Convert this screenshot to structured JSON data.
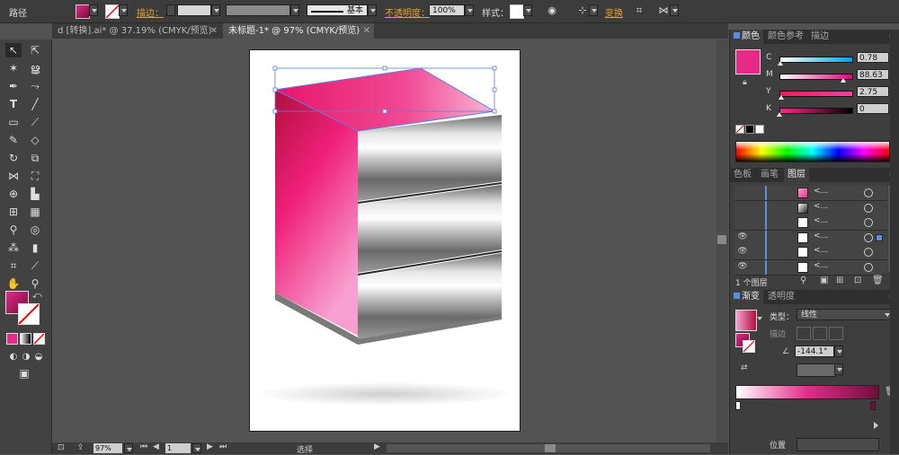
{
  "control_bar": {
    "object_type": "路径",
    "stroke_label": "描边：",
    "stroke_profile": "基本",
    "opacity_label": "不透明度：",
    "opacity_value": "100%",
    "style_label": "样式：",
    "transform_label": "变换"
  },
  "tabs": [
    {
      "label": "d [转换].ai* @ 37.19% (CMYK/预览)"
    },
    {
      "label": "未标题-1* @ 97% (CMYK/预览)"
    }
  ],
  "color_panel": {
    "tabs": [
      "颜色",
      "颜色参考",
      "描边"
    ],
    "swatch_color": "#e8298a",
    "channels": [
      {
        "key": "C",
        "value": "0.78",
        "thumb": 0.01,
        "gradient": "linear-gradient(to right,#fff,#00a0e9)"
      },
      {
        "key": "M",
        "value": "88.63",
        "thumb": 0.89,
        "gradient": "linear-gradient(to right,#fff,#e4007f)"
      },
      {
        "key": "Y",
        "value": "2.75",
        "thumb": 0.03,
        "gradient": "linear-gradient(to right,#ff1a5a,#ff3ea0)"
      },
      {
        "key": "K",
        "value": "0",
        "thumb": 0.0,
        "gradient": "linear-gradient(to right,#ff2a8a,#000)"
      }
    ]
  },
  "layers_panel": {
    "tabs": [
      "色板",
      "画笔",
      "图层"
    ],
    "rows": [
      {
        "name": "<...",
        "visible": false
      },
      {
        "name": "<...",
        "visible": false
      },
      {
        "name": "<...",
        "visible": false
      },
      {
        "name": "<...",
        "visible": true
      },
      {
        "name": "<...",
        "visible": true
      },
      {
        "name": "<...",
        "visible": true
      }
    ],
    "count": "1 个图层"
  },
  "gradient_panel": {
    "tabs": [
      "渐变",
      "透明度"
    ],
    "type_label": "类型：",
    "type_value": "线性",
    "stroke_label": "描边",
    "angle_value": "-144.1°",
    "location_label": "位置"
  },
  "status_bar": {
    "zoom": "97%",
    "page": "1",
    "tool": "选择"
  },
  "colors": {
    "accent_pink": "#e8298a",
    "panel_bg": "#3e3e3e",
    "ui_orange": "#e8a02a"
  },
  "icons": [
    "selection-tool-icon",
    "direct-selection-icon",
    "magic-wand-icon",
    "lasso-icon",
    "pen-icon",
    "curvature-icon",
    "type-icon",
    "line-icon",
    "rectangle-icon",
    "paintbrush-icon",
    "pencil-icon",
    "eraser-icon",
    "rotate-icon",
    "scale-icon",
    "width-icon",
    "free-transform-icon",
    "shape-builder-icon",
    "perspective-icon",
    "mesh-icon",
    "gradient-icon",
    "eyedropper-icon",
    "blend-icon",
    "symbol-sprayer-icon",
    "graph-icon",
    "artboard-icon",
    "slice-icon",
    "hand-icon",
    "zoom-icon"
  ]
}
